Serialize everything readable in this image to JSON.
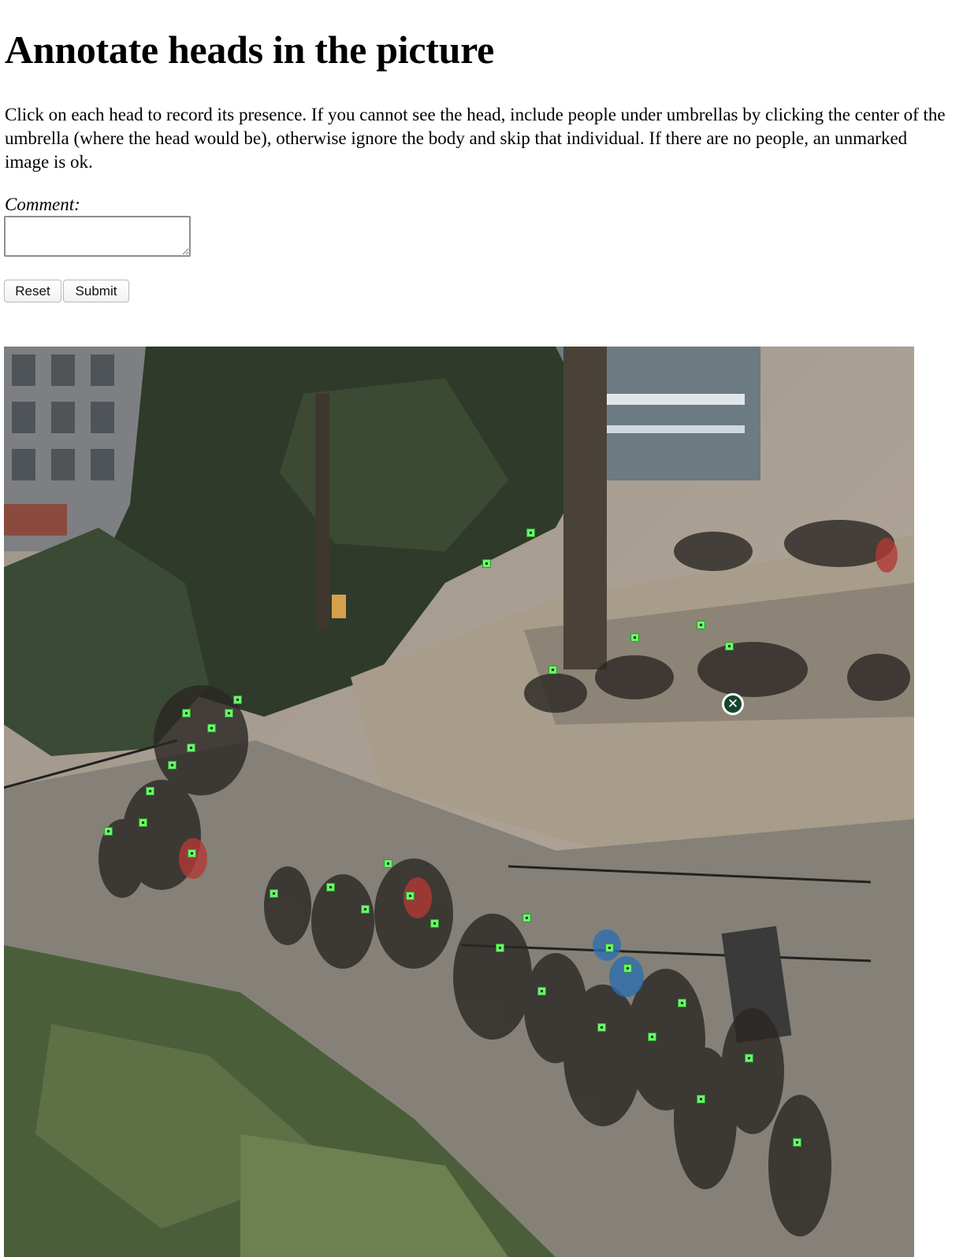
{
  "page": {
    "title": "Annotate heads in the picture",
    "instructions": "Click on each head to record its presence. If you cannot see the head, include people under umbrellas by clicking the center of the umbrella (where the head would be), otherwise ignore the body and skip that individual. If there are no people, an unmarked image is ok."
  },
  "form": {
    "comment_label": "Comment:",
    "comment_value": "",
    "reset_label": "Reset",
    "submit_label": "Submit"
  },
  "image": {
    "description_icon": "crowd-photo",
    "marker_color": "#6cf36c",
    "delete_icon": "close-circle-icon",
    "delete_glyph": "✕"
  }
}
